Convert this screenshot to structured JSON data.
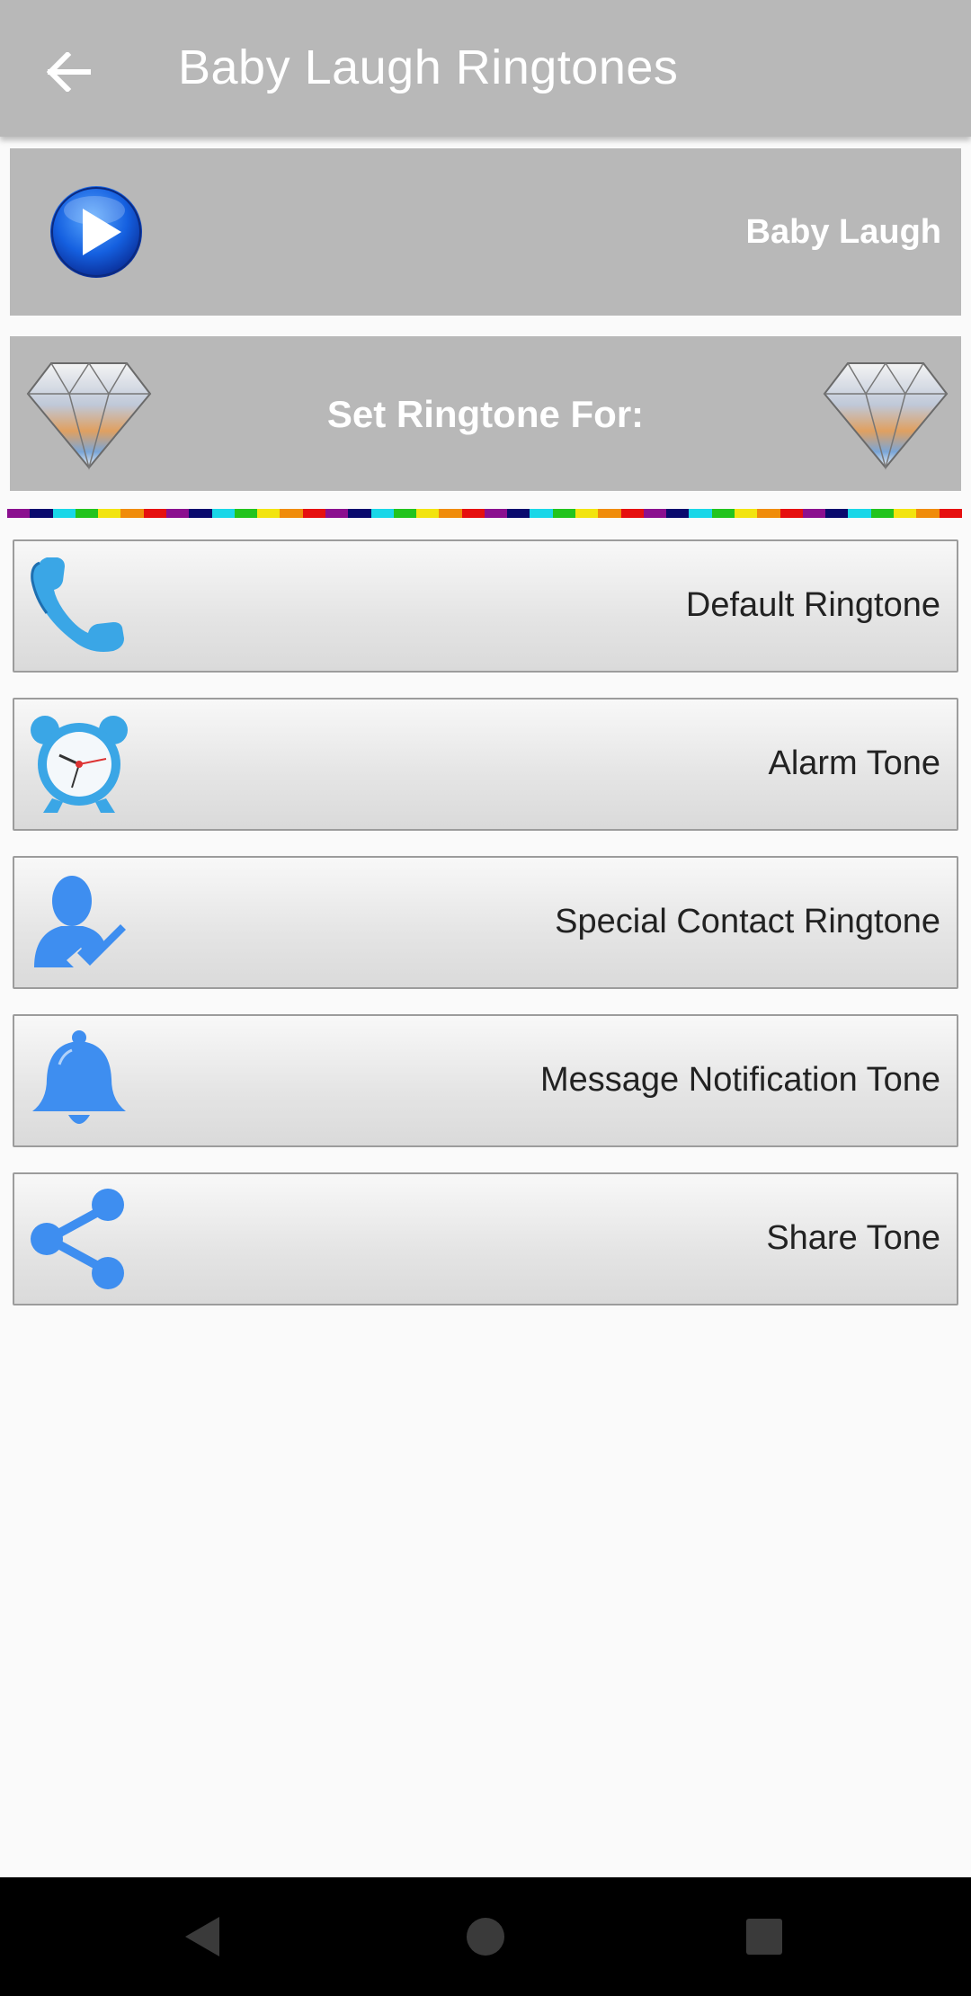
{
  "app_bar": {
    "title": "Baby Laugh Ringtones",
    "back_icon": "arrow-left-icon"
  },
  "player": {
    "tone_name": "Baby Laugh",
    "play_icon": "play-icon"
  },
  "set_ringtone": {
    "label": "Set Ringtone For:",
    "decor_icon": "diamond-icon"
  },
  "stripe_colors": [
    "#8b0f8f",
    "#0a0a6e",
    "#19d7e8",
    "#22c41e",
    "#f2e40f",
    "#f08c0a",
    "#e60f0f",
    "#8b0f8f",
    "#0a0a6e",
    "#19d7e8",
    "#22c41e",
    "#f2e40f",
    "#f08c0a",
    "#e60f0f",
    "#8b0f8f",
    "#0a0a6e",
    "#19d7e8",
    "#22c41e",
    "#f2e40f",
    "#f08c0a",
    "#e60f0f",
    "#8b0f8f",
    "#0a0a6e",
    "#19d7e8",
    "#22c41e",
    "#f2e40f",
    "#f08c0a",
    "#e60f0f",
    "#8b0f8f",
    "#0a0a6e",
    "#19d7e8",
    "#22c41e",
    "#f2e40f",
    "#f08c0a",
    "#e60f0f",
    "#8b0f8f",
    "#0a0a6e",
    "#19d7e8",
    "#22c41e",
    "#f2e40f",
    "#f08c0a",
    "#e60f0f"
  ],
  "actions": [
    {
      "label": "Default Ringtone",
      "icon": "phone-icon"
    },
    {
      "label": "Alarm Tone",
      "icon": "alarm-clock-icon"
    },
    {
      "label": "Special Contact Ringtone",
      "icon": "contact-check-icon"
    },
    {
      "label": "Message Notification Tone",
      "icon": "bell-icon"
    },
    {
      "label": "Share Tone",
      "icon": "share-icon"
    }
  ],
  "colors": {
    "header_gray": "#b8b8b8",
    "icon_blue": "#3e8ef0"
  },
  "nav": {
    "back_icon": "nav-back-icon",
    "home_icon": "nav-home-icon",
    "recents_icon": "nav-recents-icon"
  }
}
